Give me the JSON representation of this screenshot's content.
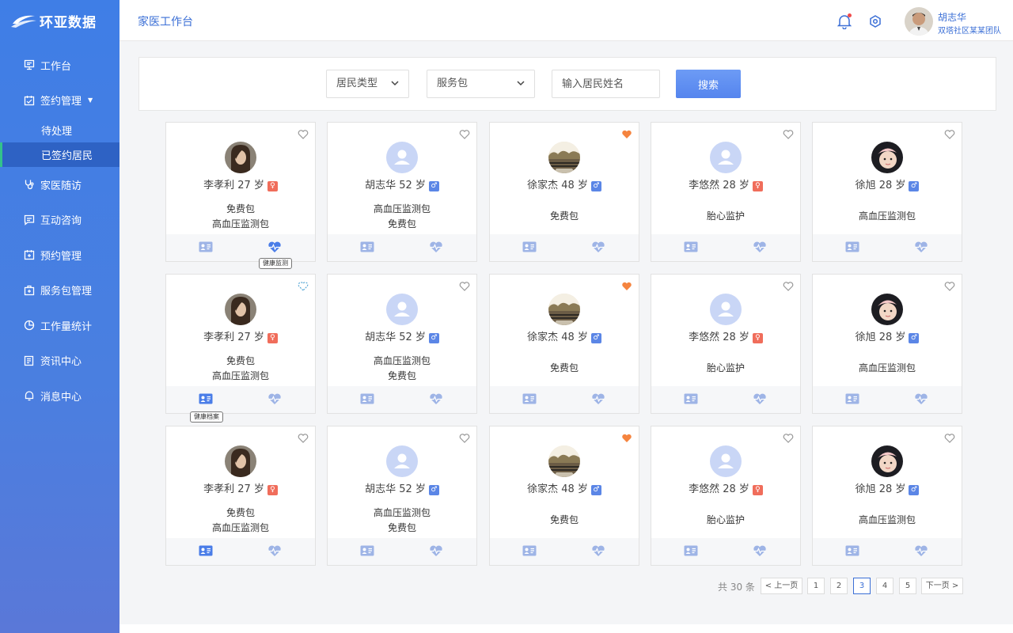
{
  "app": {
    "logo_text": "环亚数据"
  },
  "header": {
    "title": "家医工作台",
    "user_name": "胡志华",
    "user_team": "双塔社区某某团队"
  },
  "sidebar": {
    "items": [
      {
        "label": "工作台",
        "icon": "desktop-icon"
      },
      {
        "label": "签约管理",
        "icon": "contract-icon",
        "sub": [
          "待处理",
          "已签约居民"
        ],
        "active_sub": 1
      },
      {
        "label": "家医随访",
        "icon": "stethoscope-icon"
      },
      {
        "label": "互动咨询",
        "icon": "chat-icon"
      },
      {
        "label": "预约管理",
        "icon": "calendar-icon"
      },
      {
        "label": "服务包管理",
        "icon": "package-icon"
      },
      {
        "label": "工作量统计",
        "icon": "pie-chart-icon"
      },
      {
        "label": "资讯中心",
        "icon": "news-icon"
      },
      {
        "label": "消息中心",
        "icon": "bell-icon"
      }
    ]
  },
  "filter": {
    "type_label": "居民类型",
    "package_label": "服务包",
    "name_placeholder": "输入居民姓名",
    "search_label": "搜索"
  },
  "colors": {
    "primary": "#3b6fd6",
    "favorite": "#f5843f",
    "female": "#f06d5b",
    "male": "#5b86e6"
  },
  "residents": [
    {
      "name": "李孝利",
      "age": "27 岁",
      "sex": "female",
      "packages": [
        "免费包",
        "高血压监测包"
      ],
      "avatar": "long-hair-person"
    },
    {
      "name": "胡志华",
      "age": "52 岁",
      "sex": "male",
      "packages": [
        "高血压监测包",
        "免费包"
      ],
      "avatar": "default-avatar"
    },
    {
      "name": "徐家杰",
      "age": "48 岁",
      "sex": "male",
      "packages": [
        "免费包"
      ],
      "avatar": "landscape"
    },
    {
      "name": "李悠然",
      "age": "28 岁",
      "sex": "female",
      "packages": [
        "胎心监护"
      ],
      "avatar": "default-avatar"
    },
    {
      "name": "徐旭",
      "age": "28 岁",
      "sex": "male",
      "packages": [
        "高血压监测包"
      ],
      "avatar": "baby"
    }
  ],
  "grid": [
    [
      {
        "fav": false
      },
      {
        "fav": false
      },
      {
        "fav": true
      },
      {
        "fav": false
      },
      {
        "fav": false
      }
    ],
    [
      {
        "fav": false,
        "pending": true
      },
      {
        "fav": false
      },
      {
        "fav": true
      },
      {
        "fav": false
      },
      {
        "fav": false
      }
    ],
    [
      {
        "fav": false
      },
      {
        "fav": false
      },
      {
        "fav": true
      },
      {
        "fav": false
      },
      {
        "fav": false
      }
    ]
  ],
  "tooltips": {
    "health_monitor": "健康监测",
    "health_record": "健康档案"
  },
  "pagination": {
    "total": "共 30 条",
    "prev": "< 上一页",
    "next": "下一页 >",
    "pages": [
      "1",
      "2",
      "3",
      "4",
      "5"
    ],
    "current": "3"
  }
}
